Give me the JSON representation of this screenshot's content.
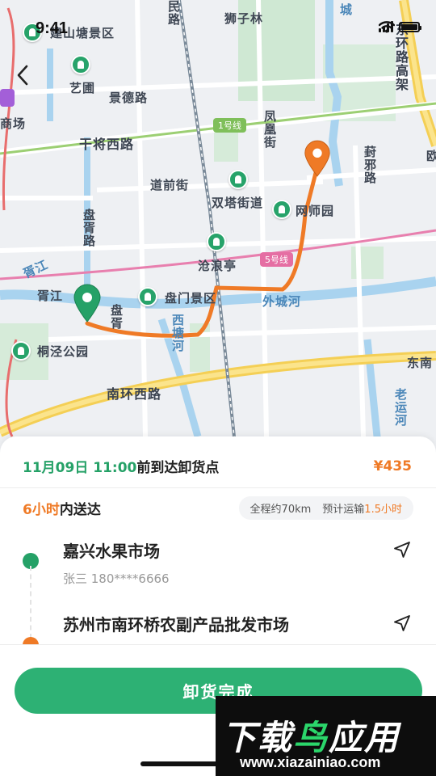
{
  "status_bar": {
    "time": "9:41",
    "battery_level": 1.0
  },
  "map": {
    "labels": {
      "scenic_top": "建山塘景区",
      "road_minggu": "民路",
      "shizilin": "狮子林",
      "city": "城",
      "east_ring": "东环路高架",
      "yiyuan": "艺圃",
      "jingde": "景德路",
      "ganjiang": "干将西路",
      "fenghuang": "凤凰街",
      "mall": "商场",
      "xiangmen": "葑邪路",
      "dao": "道前街",
      "shuangta": "双塔街道",
      "wangshi": "网师园",
      "panxu": "盘胥路",
      "xujiang": "胥江",
      "canglang": "沧浪亭",
      "xujiang2": "胥江",
      "panmen": "盘门景区",
      "waicheng": "外城河",
      "tongjing": "桐泾公园",
      "panxu2": "盘胥",
      "xitang": "西塘河",
      "dongnan": "东南",
      "nanhuan": "南环西路",
      "laoyun": "老运河",
      "ou": "欧"
    },
    "metro": {
      "line1": "1号线",
      "line5": "5号线"
    }
  },
  "order": {
    "date": "11月09日",
    "time": "11:00",
    "eta_suffix": "前到达卸货点",
    "price": "¥435",
    "deliver_hours": "6小时",
    "deliver_suffix": "内送达",
    "distance": "全程约70km",
    "transport_prefix": "预计运输",
    "transport_hours": "1.5",
    "transport_unit": "小时"
  },
  "stops": [
    {
      "name": "嘉兴水果市场",
      "contact": "张三 180****6666",
      "color": "#25a167"
    },
    {
      "name": "苏州市南环桥农副产品批发市场",
      "color": "#ef7a26"
    }
  ],
  "actions": {
    "complete_label": "卸货完成"
  },
  "watermark": {
    "title_a": "下载",
    "title_b": "鸟",
    "title_c": "应用",
    "url": "www.xiazainiao.com"
  },
  "colors": {
    "accent": "#2db174",
    "origin": "#25a167",
    "destination": "#ef7a26",
    "route": "#ef7a26"
  }
}
